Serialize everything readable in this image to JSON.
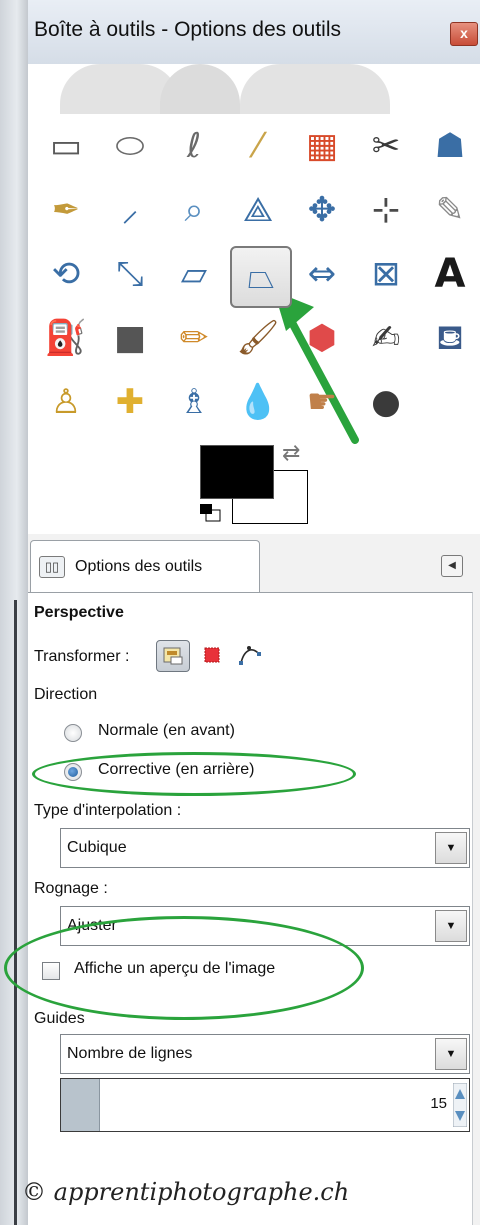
{
  "window": {
    "title": "Boîte à outils - Options des outils",
    "close_glyph": "x"
  },
  "toolbox": {
    "tools": [
      {
        "name": "rect-select-icon",
        "glyph": "▭",
        "color": "#5a5a5a"
      },
      {
        "name": "ellipse-select-icon",
        "glyph": "⬭",
        "color": "#6a6a6a"
      },
      {
        "name": "free-select-icon",
        "glyph": "ℓ",
        "color": "#6a6a6a"
      },
      {
        "name": "fuzzy-select-icon",
        "glyph": "⁄",
        "color": "#c9a44a"
      },
      {
        "name": "select-by-color-icon",
        "glyph": "▦",
        "color": "#d84a2a"
      },
      {
        "name": "scissors-select-icon",
        "glyph": "✂",
        "color": "#3a3a3a"
      },
      {
        "name": "foreground-select-icon",
        "glyph": "☗",
        "color": "#3a6ea5"
      },
      {
        "name": "paths-icon",
        "glyph": "✒",
        "color": "#c39a3a"
      },
      {
        "name": "color-picker-icon",
        "glyph": "⸝",
        "color": "#3a6ea5"
      },
      {
        "name": "zoom-icon",
        "glyph": "⌕",
        "color": "#5a8fc0"
      },
      {
        "name": "measure-icon",
        "glyph": "⟁",
        "color": "#3a6ea5"
      },
      {
        "name": "move-icon",
        "glyph": "✥",
        "color": "#3a6ea5"
      },
      {
        "name": "align-icon",
        "glyph": "⊹",
        "color": "#4a4a4a"
      },
      {
        "name": "crop-icon",
        "glyph": "✎",
        "color": "#8a8a8a"
      },
      {
        "name": "rotate-icon",
        "glyph": "⟲",
        "color": "#3a6ea5"
      },
      {
        "name": "scale-icon",
        "glyph": "⤡",
        "color": "#3a6ea5"
      },
      {
        "name": "shear-icon",
        "glyph": "▱",
        "color": "#3a6ea5"
      },
      {
        "name": "perspective-icon",
        "glyph": "⏢",
        "color": "#3a6ea5"
      },
      {
        "name": "flip-icon",
        "glyph": "⇔",
        "color": "#3a6ea5"
      },
      {
        "name": "cage-transform-icon",
        "glyph": "⊠",
        "color": "#3a6ea5"
      },
      {
        "name": "text-icon",
        "glyph": "A",
        "color": "#1a1a1a"
      },
      {
        "name": "bucket-fill-icon",
        "glyph": "⛽",
        "color": "#5a6a7a"
      },
      {
        "name": "blend-icon",
        "glyph": "■",
        "color": "#555555"
      },
      {
        "name": "pencil-icon",
        "glyph": "✏",
        "color": "#d08a2a"
      },
      {
        "name": "paintbrush-icon",
        "glyph": "🖌",
        "color": "#8a5a2a"
      },
      {
        "name": "eraser-icon",
        "glyph": "⬢",
        "color": "#e04a4a"
      },
      {
        "name": "airbrush-icon",
        "glyph": "✍",
        "color": "#3a3a3a"
      },
      {
        "name": "ink-icon",
        "glyph": "⛾",
        "color": "#3a5a8a"
      },
      {
        "name": "clone-icon",
        "glyph": "♙",
        "color": "#c89a2a"
      },
      {
        "name": "heal-icon",
        "glyph": "✚",
        "color": "#e0b030"
      },
      {
        "name": "perspective-clone-icon",
        "glyph": "♗",
        "color": "#3a6ea5"
      },
      {
        "name": "blur-sharpen-icon",
        "glyph": "💧",
        "color": "#4a8ac0"
      },
      {
        "name": "smudge-icon",
        "glyph": "☛",
        "color": "#c0804a"
      },
      {
        "name": "dodge-burn-icon",
        "glyph": "●",
        "color": "#3a3a3a"
      }
    ]
  },
  "colors": {
    "foreground": "#000000",
    "background": "#ffffff",
    "swap_glyph": "⇄"
  },
  "options_tab": {
    "label": "Options des outils",
    "icon_glyph": "▯▯",
    "menu_glyph": "◀"
  },
  "options": {
    "tool_name": "Perspective",
    "transform_label": "Transformer :",
    "direction_label": "Direction",
    "direction_normal": "Normale (en avant)",
    "direction_corrective": "Corrective (en arrière)",
    "direction_selected": "Corrective (en arrière)",
    "interpolation_label": "Type d'interpolation :",
    "interpolation_value": "Cubique",
    "clipping_label": "Rognage :",
    "clipping_value": "Ajuster",
    "preview_label": "Affiche un aperçu de l'image",
    "preview_checked": false,
    "guides_label": "Guides",
    "guides_value": "Nombre de lignes",
    "lines_value": "15",
    "dropdown_glyph": "▼"
  },
  "watermark": "© apprentiphotographe.ch",
  "annotation_color": "#2aa33c"
}
